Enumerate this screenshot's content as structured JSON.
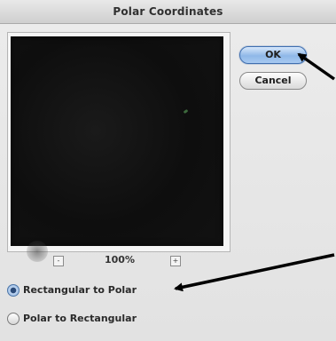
{
  "window": {
    "title": "Polar Coordinates"
  },
  "buttons": {
    "ok_label": "OK",
    "cancel_label": "Cancel"
  },
  "zoom": {
    "minus_label": "-",
    "value": "100%",
    "plus_label": "+"
  },
  "options": [
    {
      "label": "Rectangular to Polar",
      "selected": true
    },
    {
      "label": "Polar to Rectangular",
      "selected": false
    }
  ]
}
